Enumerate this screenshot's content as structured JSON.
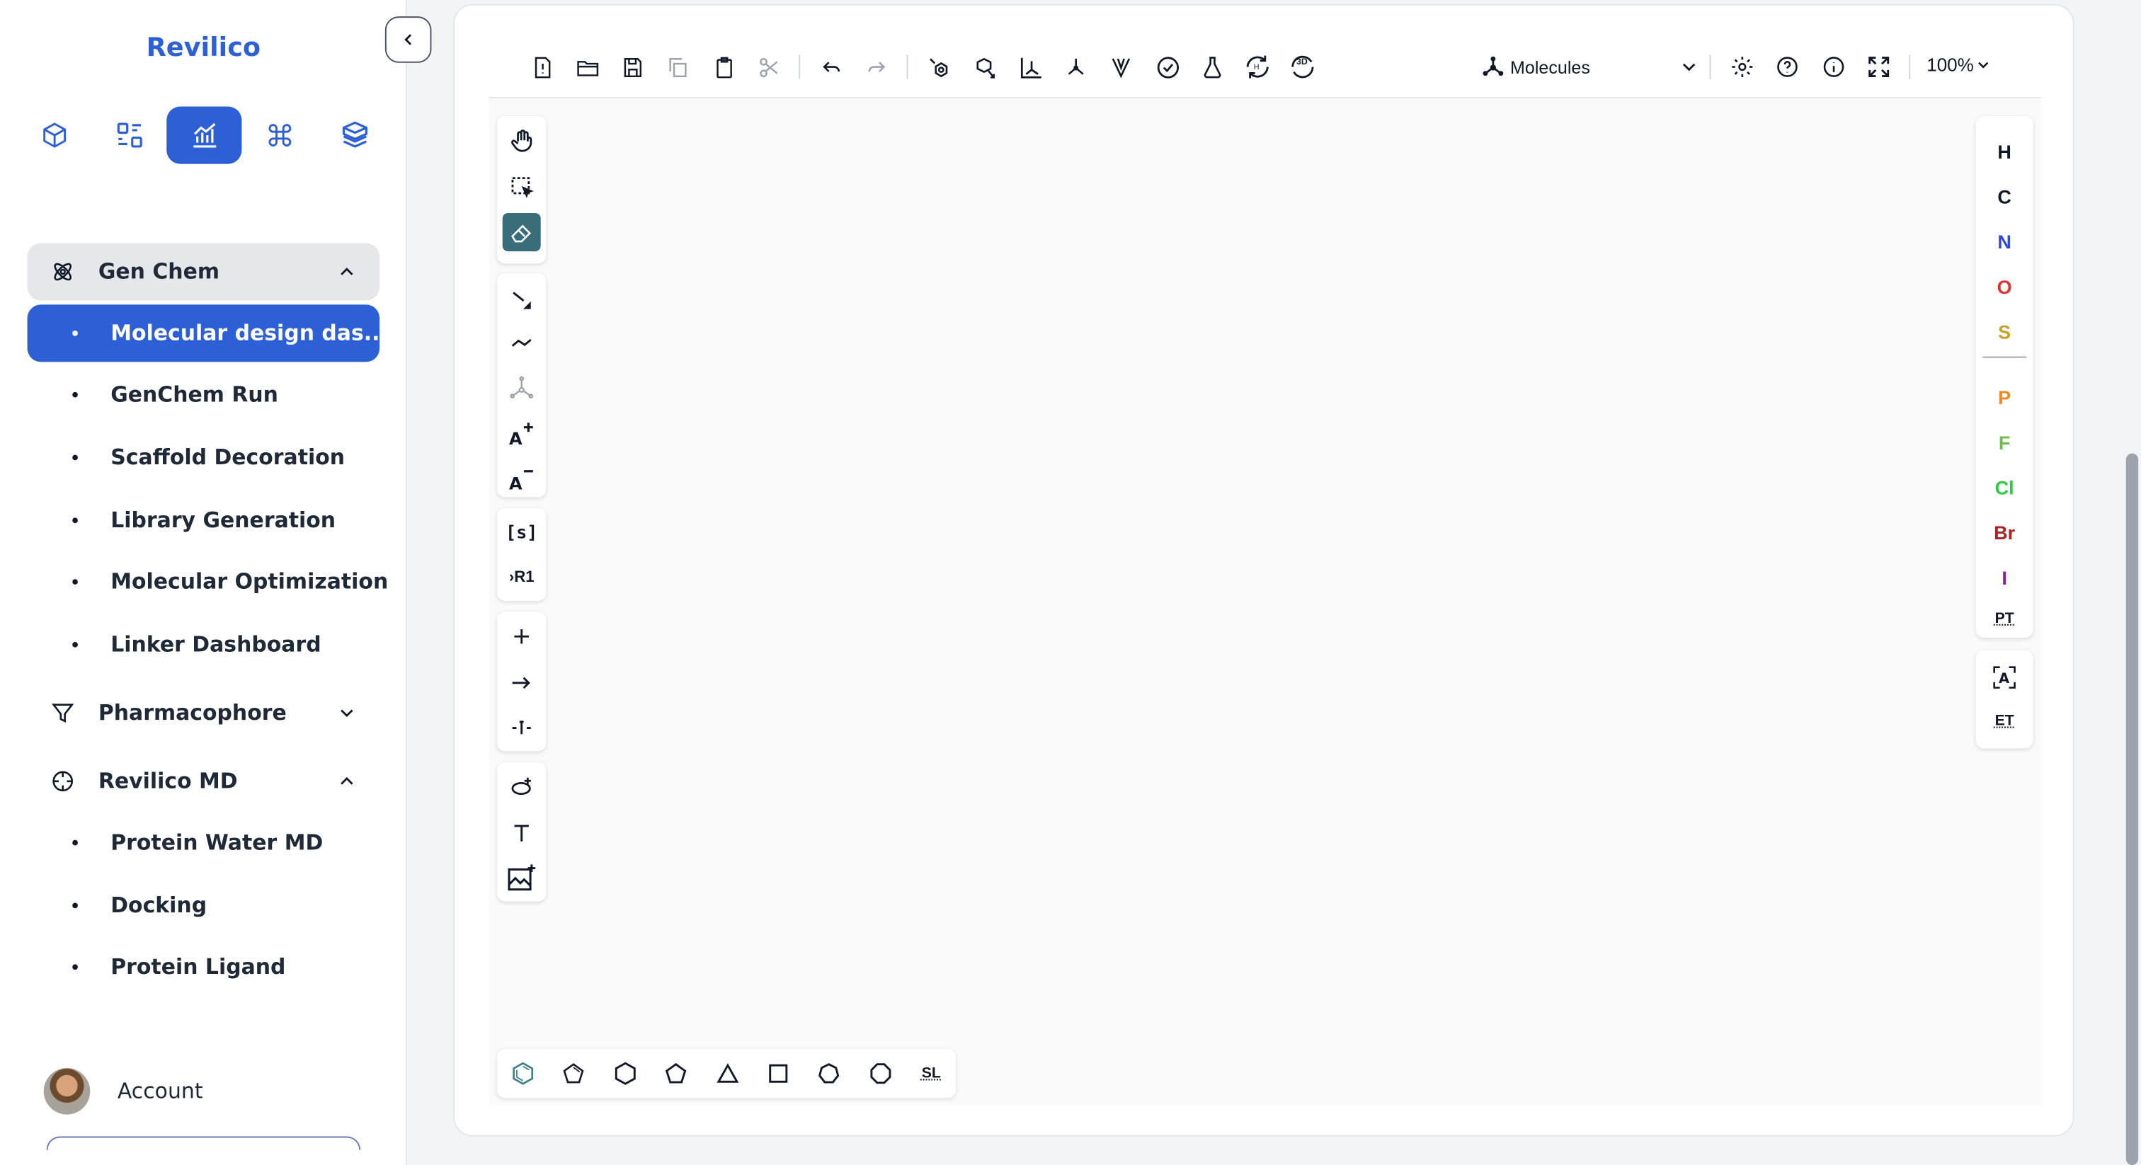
{
  "app": {
    "brand": "Revilico"
  },
  "sidebar": {
    "nav_icons": [
      "box-icon",
      "grid-swap-icon",
      "chart-icon",
      "command-icon",
      "layers-box-icon"
    ],
    "active_nav_index": 2,
    "groups": [
      {
        "label": "Gen Chem",
        "icon": "atom-icon",
        "expanded": true,
        "items": [
          "Molecular design das...",
          "GenChem Run",
          "Scaffold Decoration",
          "Library Generation",
          "Molecular Optimization",
          "Linker Dashboard"
        ],
        "active_item": "Molecular design das..."
      },
      {
        "label": "Pharmacophore",
        "icon": "filter-icon",
        "expanded": false,
        "items": []
      },
      {
        "label": "Revilico MD",
        "icon": "crosshair-icon",
        "expanded": true,
        "items": [
          "Protein Water MD",
          "Docking",
          "Protein Ligand"
        ]
      }
    ],
    "account_label": "Account"
  },
  "editor": {
    "toolbar_icons": [
      "new-file-icon",
      "open-folder-icon",
      "save-icon",
      "copy-icon",
      "paste-icon",
      "cut-icon",
      "undo-icon",
      "redo-icon",
      "aromatize-icon",
      "dearomatize-icon",
      "layout-icon",
      "clean-icon",
      "cip-icon",
      "check-icon",
      "calculate-icon",
      "stereo-icon",
      "3d-icon",
      "settings-icon",
      "help-icon",
      "info-icon",
      "fullscreen-icon"
    ],
    "mode": "Molecules",
    "zoom": "100%",
    "left_tools": [
      "hand-icon",
      "select-icon",
      "eraser-icon",
      "bond-icon",
      "chain-icon",
      "atom-bonds-icon",
      "charge-plus-icon",
      "charge-minus-icon",
      "sgroup-icon",
      "rgroup-icon",
      "plus-icon",
      "arrow-icon",
      "attachment-icon",
      "template-icon",
      "text-icon",
      "image-icon"
    ],
    "active_tool": "eraser-icon",
    "rgroup_label": "R1",
    "sgroup_label": "[s]",
    "elements": [
      {
        "symbol": "H",
        "color": "#111827"
      },
      {
        "symbol": "C",
        "color": "#111827"
      },
      {
        "symbol": "N",
        "color": "#2f4bd6"
      },
      {
        "symbol": "O",
        "color": "#e5302f"
      },
      {
        "symbol": "S",
        "color": "#c9a227"
      },
      {
        "symbol": "P",
        "color": "#f08a24"
      },
      {
        "symbol": "F",
        "color": "#6cc04a"
      },
      {
        "symbol": "Cl",
        "color": "#2ecc40"
      },
      {
        "symbol": "Br",
        "color": "#a82323"
      },
      {
        "symbol": "I",
        "color": "#8b1fa8"
      }
    ],
    "periodic_table_label": "PT",
    "extended_table_label": "ET",
    "shapes": [
      "benzene-icon",
      "cyclopentadiene-icon",
      "cyclohexane-icon",
      "cyclopentane-icon",
      "cyclopropane-icon",
      "cyclobutane-icon",
      "cycloheptane-icon",
      "cyclooctane-icon"
    ],
    "structure_library_label": "SL"
  }
}
